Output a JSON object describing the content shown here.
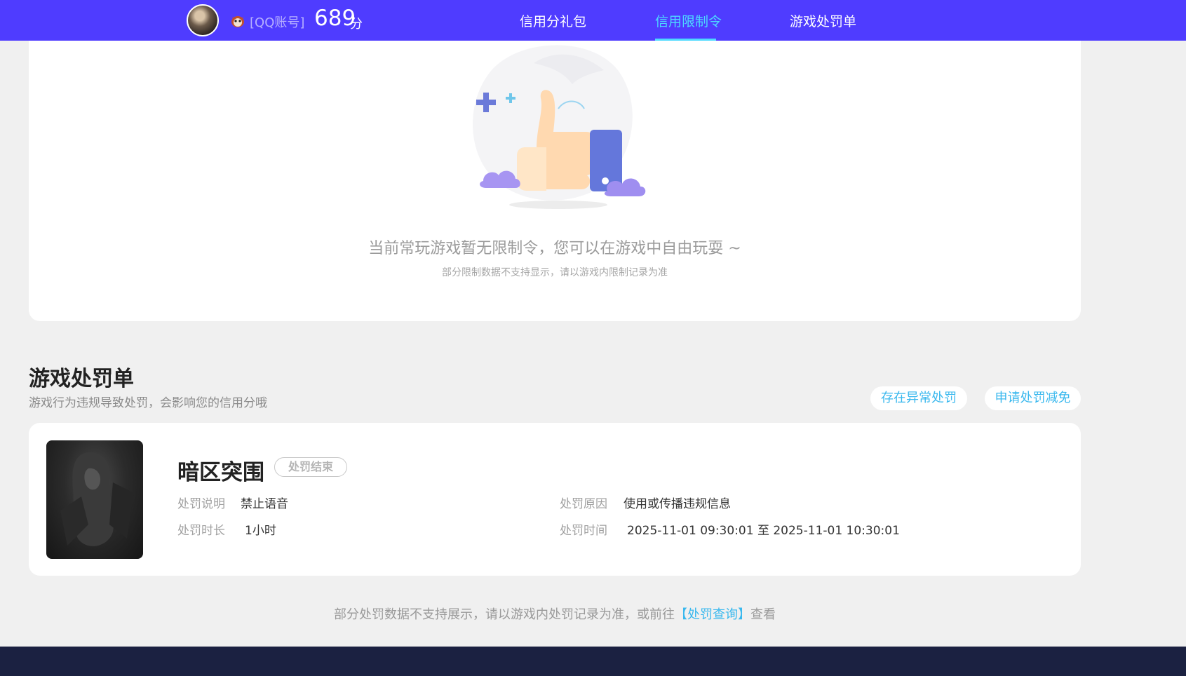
{
  "header": {
    "account_label": "[QQ账号]",
    "score": "689",
    "score_unit": "分",
    "tabs": [
      {
        "label": "信用分礼包"
      },
      {
        "label": "信用限制令"
      },
      {
        "label": "游戏处罚单"
      }
    ],
    "active_tab": "信用限制令"
  },
  "restriction": {
    "empty_title": "当前常玩游戏暂无限制令，您可以在游戏中自由玩耍 ~",
    "empty_sub": "部分限制数据不支持显示，请以游戏内限制记录为准"
  },
  "penalty_section": {
    "title": "游戏处罚单",
    "subtitle": "游戏行为违规导致处罚，会影响您的信用分哦",
    "buttons": {
      "report_abnormal": "存在异常处罚",
      "apply_reduction": "申请处罚减免"
    },
    "records": [
      {
        "game_name": "暗区突围",
        "status": "处罚结束",
        "desc_label": "处罚说明",
        "desc_value": "禁止语音",
        "duration_label": "处罚时长",
        "duration_value": "1小时",
        "reason_label": "处罚原因",
        "reason_value": "使用或传播违规信息",
        "time_label": "处罚时间",
        "time_value": "2025-11-01 09:30:01 至 2025-11-01 10:30:01"
      }
    ],
    "note_prefix": "部分处罚数据不支持展示，请以游戏内处罚记录为准，或前往",
    "note_link": "【处罚查询】",
    "note_suffix": "查看"
  },
  "colors": {
    "topbar": "#4f3cff",
    "accent": "#4dd9ff",
    "link": "#39b8ee",
    "footer": "#1b2141",
    "background": "#f0f0f0"
  }
}
